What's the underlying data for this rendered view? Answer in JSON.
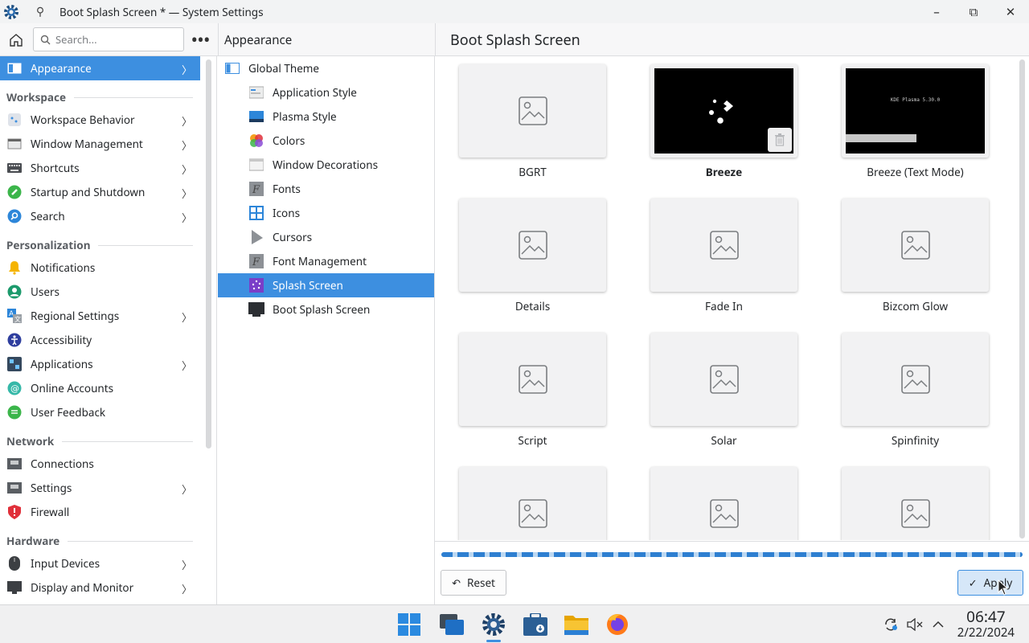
{
  "window": {
    "title": "Boot Splash Screen * — System Settings",
    "pin_glyph": "⚲",
    "controls": {
      "minimize": "–",
      "maximize": "⧉",
      "close": "✕"
    }
  },
  "header": {
    "search_placeholder": "Search...",
    "more": "•••",
    "column2_title": "Appearance",
    "column3_title": "Boot Splash Screen"
  },
  "sidebar": {
    "items": [
      {
        "label": "Appearance",
        "icon": "appearance-icon",
        "active": true,
        "chevron": true
      },
      {
        "section": "Workspace"
      },
      {
        "label": "Workspace Behavior",
        "icon": "workspace-behavior-icon",
        "chevron": true
      },
      {
        "label": "Window Management",
        "icon": "window-management-icon",
        "chevron": true
      },
      {
        "label": "Shortcuts",
        "icon": "keyboard-icon",
        "chevron": true
      },
      {
        "label": "Startup and Shutdown",
        "icon": "rocket-icon",
        "chevron": true
      },
      {
        "label": "Search",
        "icon": "search-icon",
        "chevron": true
      },
      {
        "section": "Personalization"
      },
      {
        "label": "Notifications",
        "icon": "bell-icon",
        "chevron": false
      },
      {
        "label": "Users",
        "icon": "user-icon",
        "chevron": false
      },
      {
        "label": "Regional Settings",
        "icon": "language-icon",
        "chevron": true
      },
      {
        "label": "Accessibility",
        "icon": "accessibility-icon",
        "chevron": false
      },
      {
        "label": "Applications",
        "icon": "applications-icon",
        "chevron": true
      },
      {
        "label": "Online Accounts",
        "icon": "at-icon",
        "chevron": false
      },
      {
        "label": "User Feedback",
        "icon": "feedback-icon",
        "chevron": false
      },
      {
        "section": "Network"
      },
      {
        "label": "Connections",
        "icon": "network-icon",
        "chevron": false
      },
      {
        "label": "Settings",
        "icon": "network-settings-icon",
        "chevron": true
      },
      {
        "label": "Firewall",
        "icon": "shield-icon",
        "chevron": false
      },
      {
        "section": "Hardware"
      },
      {
        "label": "Input Devices",
        "icon": "mouse-icon",
        "chevron": true
      },
      {
        "label": "Display and Monitor",
        "icon": "monitor-icon",
        "chevron": true
      }
    ]
  },
  "column2": {
    "items": [
      {
        "label": "Global Theme",
        "icon": "global-theme-icon",
        "indent": false
      },
      {
        "label": "Application Style",
        "icon": "application-style-icon",
        "indent": true
      },
      {
        "label": "Plasma Style",
        "icon": "plasma-style-icon",
        "indent": true
      },
      {
        "label": "Colors",
        "icon": "colors-icon",
        "indent": true
      },
      {
        "label": "Window Decorations",
        "icon": "window-decorations-icon",
        "indent": true
      },
      {
        "label": "Fonts",
        "icon": "fonts-icon",
        "indent": true
      },
      {
        "label": "Icons",
        "icon": "icons-icon",
        "indent": true
      },
      {
        "label": "Cursors",
        "icon": "cursor-icon",
        "indent": true
      },
      {
        "label": "Font Management",
        "icon": "font-management-icon",
        "indent": true
      },
      {
        "label": "Splash Screen",
        "icon": "splash-screen-icon",
        "indent": true,
        "active": true
      },
      {
        "label": "Boot Splash Screen",
        "icon": "boot-splash-icon",
        "indent": true
      }
    ]
  },
  "themes": [
    {
      "label": "BGRT",
      "preview": "placeholder"
    },
    {
      "label": "Breeze",
      "preview": "breeze",
      "selected": true,
      "has_delete": true
    },
    {
      "label": "Breeze (Text Mode)",
      "preview": "text",
      "preview_text": "KDE Plasma 5.30.0"
    },
    {
      "label": "Details",
      "preview": "placeholder"
    },
    {
      "label": "Fade In",
      "preview": "placeholder"
    },
    {
      "label": "Bizcom Glow",
      "preview": "placeholder"
    },
    {
      "label": "Script",
      "preview": "placeholder"
    },
    {
      "label": "Solar",
      "preview": "placeholder"
    },
    {
      "label": "Spinfinity",
      "preview": "placeholder"
    },
    {
      "label": "",
      "preview": "placeholder"
    },
    {
      "label": "",
      "preview": "placeholder"
    },
    {
      "label": "",
      "preview": "placeholder"
    }
  ],
  "footer": {
    "reset_label": "Reset",
    "apply_label": "Apply",
    "progress": "indeterminate"
  },
  "taskbar": {
    "apps": [
      "start-menu-icon",
      "task-view-icon",
      "system-settings-icon",
      "discover-icon",
      "file-manager-icon",
      "firefox-icon"
    ],
    "time": "06:47",
    "date": "2/22/2024"
  },
  "colors": {
    "accent": "#3d8fe0",
    "selection_text": "#ffffff",
    "window_bg": "#ffffff"
  }
}
